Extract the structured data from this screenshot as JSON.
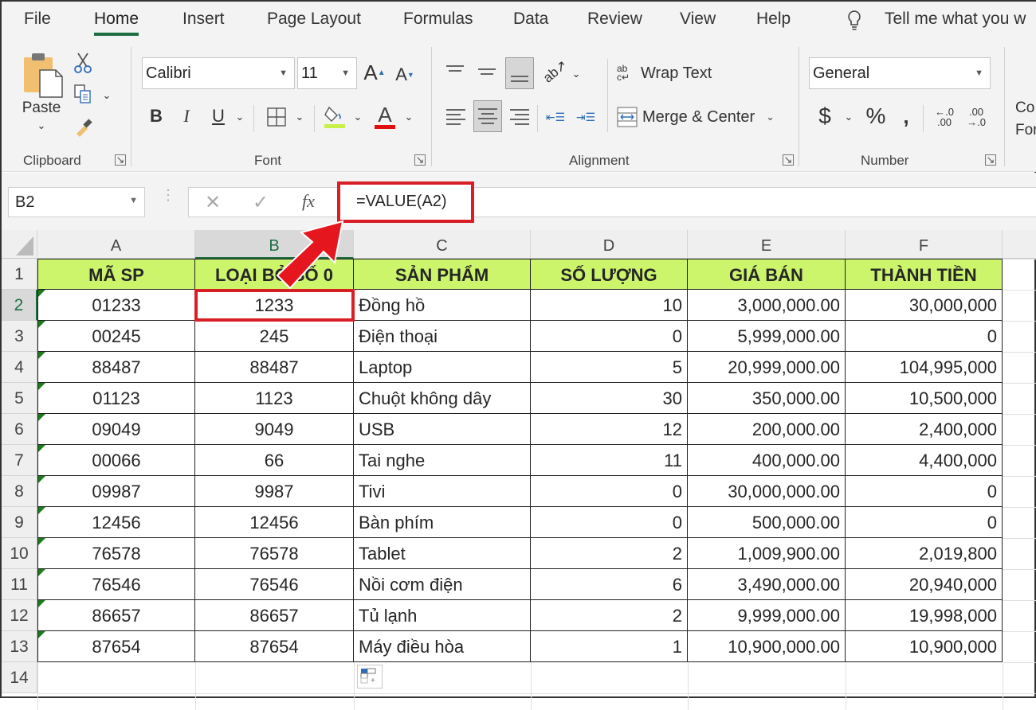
{
  "tabs": [
    {
      "label": "File",
      "active": false
    },
    {
      "label": "Home",
      "active": true
    },
    {
      "label": "Insert",
      "active": false
    },
    {
      "label": "Page Layout",
      "active": false
    },
    {
      "label": "Formulas",
      "active": false
    },
    {
      "label": "Data",
      "active": false
    },
    {
      "label": "Review",
      "active": false
    },
    {
      "label": "View",
      "active": false
    },
    {
      "label": "Help",
      "active": false
    }
  ],
  "tell_me": "Tell me what you w",
  "ribbon": {
    "clipboard": {
      "label": "Clipboard",
      "paste": "Paste"
    },
    "font": {
      "label": "Font",
      "font_name": "Calibri",
      "font_size": "11",
      "bold": "B",
      "italic": "I",
      "underline": "U",
      "grow": "A",
      "shrink": "A",
      "fill_color": "#c8f04a",
      "font_color": "#e01010"
    },
    "alignment": {
      "label": "Alignment",
      "wrap_text": "Wrap Text",
      "merge_center": "Merge & Center",
      "wrap_icon": "ab c"
    },
    "number": {
      "label": "Number",
      "format": "General",
      "currency": "$",
      "percent": "%",
      "comma": "❟",
      "inc_decimal_top": "←.0",
      "inc_decimal_bottom": ".00",
      "dec_decimal_top": ".00",
      "dec_decimal_bottom": "→.0"
    },
    "styles_partial": {
      "line1": "Co",
      "line2": "For"
    }
  },
  "formula_bar": {
    "name_box": "B2",
    "cancel": "✕",
    "enter": "✓",
    "fx": "fx",
    "formula": "=VALUE(A2)"
  },
  "annotation_color": "#d91f26",
  "columns": [
    "A",
    "B",
    "C",
    "D",
    "E",
    "F"
  ],
  "selected_cell": "B2",
  "header_fill": "#ccf56c",
  "headers": [
    "MÃ SP",
    "LOẠI BỎ SỐ 0",
    "SẢN PHẨM",
    "SỐ LƯỢNG",
    "GIÁ BÁN",
    "THÀNH TIỀN"
  ],
  "rows": [
    {
      "n": "2",
      "a": "01233",
      "b": "1233",
      "c": "Đồng hồ",
      "d": "10",
      "e": "3,000,000.00",
      "f": "30,000,000"
    },
    {
      "n": "3",
      "a": "00245",
      "b": "245",
      "c": "Điện thoại",
      "d": "0",
      "e": "5,999,000.00",
      "f": "0"
    },
    {
      "n": "4",
      "a": "88487",
      "b": "88487",
      "c": "Laptop",
      "d": "5",
      "e": "20,999,000.00",
      "f": "104,995,000"
    },
    {
      "n": "5",
      "a": "01123",
      "b": "1123",
      "c": "Chuột không dây",
      "d": "30",
      "e": "350,000.00",
      "f": "10,500,000"
    },
    {
      "n": "6",
      "a": "09049",
      "b": "9049",
      "c": "USB",
      "d": "12",
      "e": "200,000.00",
      "f": "2,400,000"
    },
    {
      "n": "7",
      "a": "00066",
      "b": "66",
      "c": "Tai nghe",
      "d": "11",
      "e": "400,000.00",
      "f": "4,400,000"
    },
    {
      "n": "8",
      "a": "09987",
      "b": "9987",
      "c": "Tivi",
      "d": "0",
      "e": "30,000,000.00",
      "f": "0"
    },
    {
      "n": "9",
      "a": "12456",
      "b": "12456",
      "c": "Bàn phím",
      "d": "0",
      "e": "500,000.00",
      "f": "0"
    },
    {
      "n": "10",
      "a": "76578",
      "b": "76578",
      "c": "Tablet",
      "d": "2",
      "e": "1,009,900.00",
      "f": "2,019,800"
    },
    {
      "n": "11",
      "a": "76546",
      "b": "76546",
      "c": "Nồi cơm điện",
      "d": "6",
      "e": "3,490,000.00",
      "f": "20,940,000"
    },
    {
      "n": "12",
      "a": "86657",
      "b": "86657",
      "c": "Tủ lạnh",
      "d": "2",
      "e": "9,999,000.00",
      "f": "19,998,000"
    },
    {
      "n": "13",
      "a": "87654",
      "b": "87654",
      "c": "Máy điều hòa",
      "d": "1",
      "e": "10,900,000.00",
      "f": "10,900,000"
    }
  ],
  "row_numbers": [
    "1",
    "14"
  ]
}
